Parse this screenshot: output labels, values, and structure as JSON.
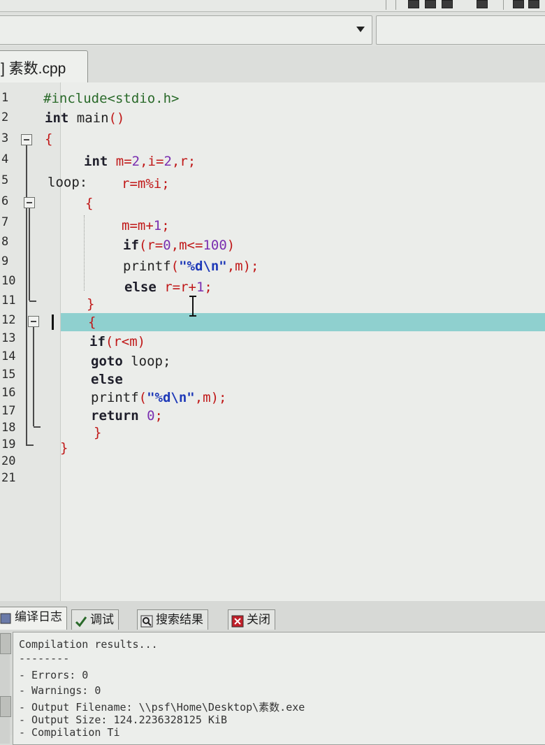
{
  "file_tab": {
    "label": "] 素数.cpp"
  },
  "gutter": {
    "line_numbers": [
      "1",
      "2",
      "3",
      "4",
      "5",
      "6",
      "7",
      "8",
      "9",
      "10",
      "11",
      "12",
      "13",
      "14",
      "15",
      "16",
      "17",
      "18",
      "19",
      "20",
      "21"
    ]
  },
  "code": {
    "l1": "#include<stdio.h>",
    "l2a": "int",
    "l2b": " main",
    "l2c": "()",
    "l3": "{",
    "l4a": "int",
    "l4b": " m=",
    "l4c": "2",
    "l4d": ",i=",
    "l4e": "2",
    "l4f": ",r;",
    "l5a": "loop:",
    "l5b": "r=m%i;",
    "l6": "{",
    "l7a": "m=m+",
    "l7b": "1",
    "l7c": ";",
    "l8a": "if",
    "l8b": "(r=",
    "l8c": "0",
    "l8d": ",m<=",
    "l8e": "100",
    "l8f": ")",
    "l9a": "printf",
    "l9b": "(",
    "l9c": "\"%d\\n\"",
    "l9d": ",m);",
    "l10a": "else",
    "l10b": " r=r+",
    "l10c": "1",
    "l10d": ";",
    "l11": "}",
    "l12": "{",
    "l13a": "if",
    "l13b": "(r<m)",
    "l14a": "goto",
    "l14b": " loop;",
    "l15": "else",
    "l16a": "printf",
    "l16b": "(",
    "l16c": "\"%d\\n\"",
    "l16d": ",m);",
    "l17a": "return",
    "l17b": " ",
    "l17c": "0",
    "l17d": ";",
    "l18": "}",
    "l19": "}"
  },
  "bottom_tabs": {
    "compile_log": "编译日志",
    "debug": "调试",
    "search_results": "搜索结果",
    "close": "关闭"
  },
  "output": {
    "line1": "Compilation results...",
    "line2": "--------",
    "line3": "- Errors: 0",
    "line4": "- Warnings: 0",
    "line5": "- Output Filename: \\\\psf\\Home\\Desktop\\素数.exe",
    "line6": "- Output Size: 124.2236328125 KiB",
    "line7": "- Compilation Ti"
  },
  "colors": {
    "current_line_highlight": "#8fd0cf",
    "operator_red": "#c01818",
    "string_blue": "#1f3ab8",
    "number_purple": "#7a2fb0"
  }
}
